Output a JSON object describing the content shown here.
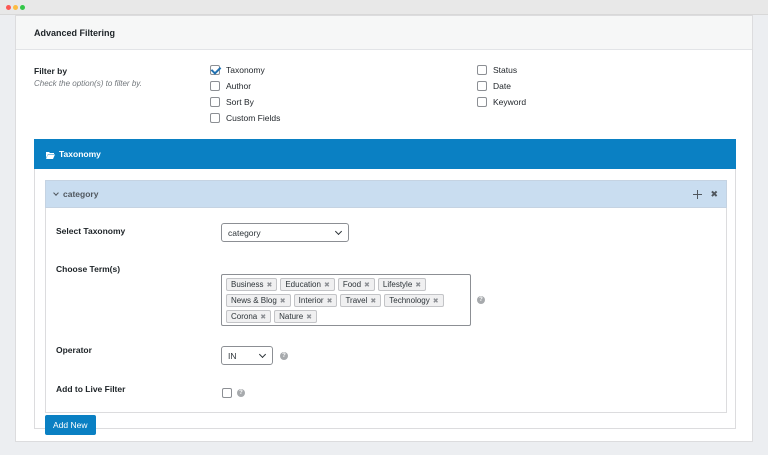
{
  "panel": {
    "title": "Advanced Filtering"
  },
  "filter_by": {
    "label": "Filter by",
    "description": "Check the option(s) to filter by.",
    "options_left": [
      {
        "label": "Taxonomy",
        "checked": true
      },
      {
        "label": "Author",
        "checked": false
      },
      {
        "label": "Sort By",
        "checked": false
      },
      {
        "label": "Custom Fields",
        "checked": false
      }
    ],
    "options_right": [
      {
        "label": "Status",
        "checked": false
      },
      {
        "label": "Date",
        "checked": false
      },
      {
        "label": "Keyword",
        "checked": false
      }
    ]
  },
  "taxonomy_bar": {
    "title": "Taxonomy",
    "icon": "folder-open-icon"
  },
  "category_box": {
    "title": "category",
    "select_taxonomy": {
      "label": "Select Taxonomy",
      "value": "category"
    },
    "choose_terms": {
      "label": "Choose Term(s)",
      "rows": [
        [
          "Business",
          "Education",
          "Food",
          "Lifestyle"
        ],
        [
          "News & Blog",
          "Interior",
          "Travel",
          "Technology"
        ],
        [
          "Corona",
          "Nature"
        ]
      ]
    },
    "operator": {
      "label": "Operator",
      "value": "IN"
    },
    "live_filter": {
      "label": "Add to Live Filter",
      "checked": false
    },
    "help_glyph": "?",
    "remove_glyph": "✖"
  },
  "add_new_label": "Add New",
  "colors": {
    "accent": "#0a80c3",
    "category_header": "#c9ddf0"
  }
}
